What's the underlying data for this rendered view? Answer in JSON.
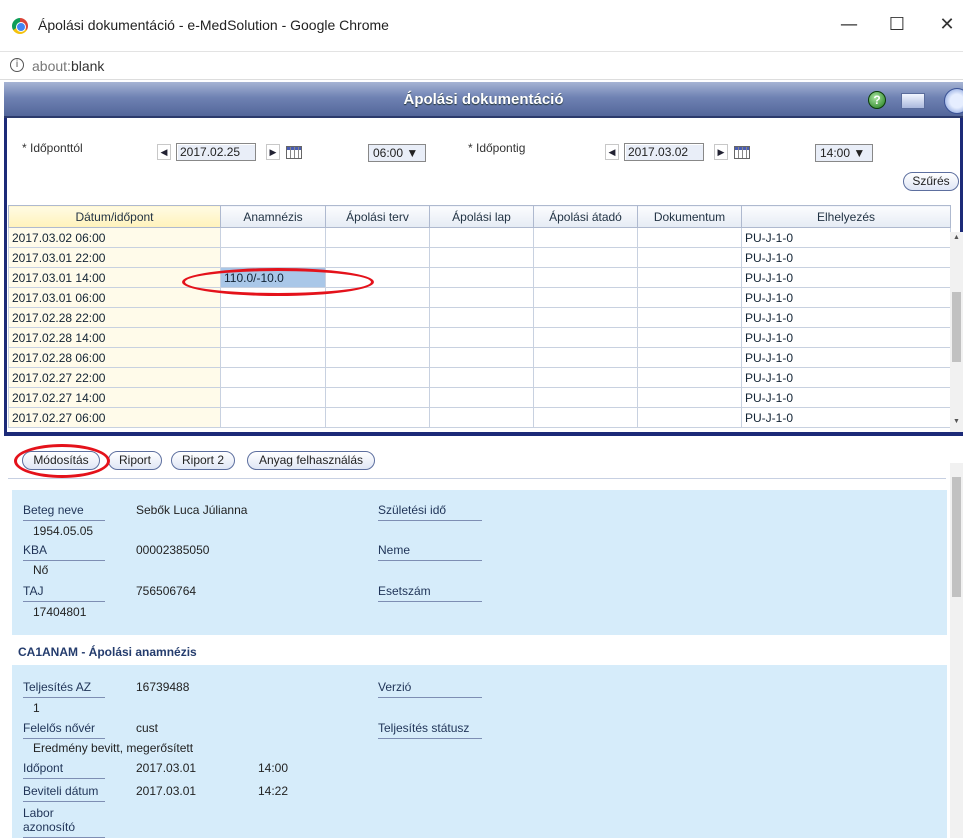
{
  "browser": {
    "window_title": "Ápolási dokumentáció - e-MedSolution - Google Chrome",
    "minimize": "—",
    "maximize": "☐",
    "close": "✕",
    "info_icon": "i",
    "address_prefix": "about:",
    "address_path": "blank"
  },
  "app": {
    "title": "Ápolási dokumentáció",
    "help_icon": "?"
  },
  "filter": {
    "from_label": "* Időponttól",
    "from_date": "2017.02.25",
    "from_time": "06:00 ▼",
    "to_label": "* Időpontig",
    "to_date": "2017.03.02",
    "to_time": "14:00 ▼",
    "prev_arrow": "◀",
    "next_arrow": "▶",
    "filter_button": "Szűrés"
  },
  "grid": {
    "columns": [
      "Dátum/időpont",
      "Anamnézis",
      "Ápolási terv",
      "Ápolási lap",
      "Ápolási átadó",
      "Dokumentum",
      "Elhelyezés"
    ],
    "rows": [
      [
        "2017.03.02 06:00",
        "",
        "",
        "",
        "",
        "",
        "PU-J-1-0"
      ],
      [
        "2017.03.01 22:00",
        "",
        "",
        "",
        "",
        "",
        "PU-J-1-0"
      ],
      [
        "2017.03.01 14:00",
        "110.0/-10.0",
        "",
        "",
        "",
        "",
        "PU-J-1-0"
      ],
      [
        "2017.03.01 06:00",
        "",
        "",
        "",
        "",
        "",
        "PU-J-1-0"
      ],
      [
        "2017.02.28 22:00",
        "",
        "",
        "",
        "",
        "",
        "PU-J-1-0"
      ],
      [
        "2017.02.28 14:00",
        "",
        "",
        "",
        "",
        "",
        "PU-J-1-0"
      ],
      [
        "2017.02.28 06:00",
        "",
        "",
        "",
        "",
        "",
        "PU-J-1-0"
      ],
      [
        "2017.02.27 22:00",
        "",
        "",
        "",
        "",
        "",
        "PU-J-1-0"
      ],
      [
        "2017.02.27 14:00",
        "",
        "",
        "",
        "",
        "",
        "PU-J-1-0"
      ],
      [
        "2017.02.27 06:00",
        "",
        "",
        "",
        "",
        "",
        "PU-J-1-0"
      ]
    ],
    "scroll_up": "▲",
    "scroll_down": "▼"
  },
  "actions": {
    "modify": "Módosítás",
    "report": "Riport",
    "report2": "Riport 2",
    "material": "Anyag felhasználás"
  },
  "patient": {
    "name_label": "Beteg neve",
    "name": "Sebők Luca Júlianna",
    "birth_label": "Születési idő",
    "birth": "1954.05.05",
    "kba_label": "KBA",
    "kba": "00002385050",
    "sex_label": "Neme",
    "sex": "Nő",
    "taj_label": "TAJ",
    "taj": "756506764",
    "case_label": "Esetszám",
    "case": "17404801"
  },
  "section": {
    "title": "CA1ANAM - Ápolási anamnézis",
    "fulfil_label": "Teljesítés AZ",
    "fulfil": "16739488",
    "version_label": "Verzió",
    "version": "1",
    "nurse_label": "Felelős nővér",
    "nurse": "cust",
    "status_label": "Teljesítés státusz",
    "status": "Eredmény bevitt, megerősített",
    "time_label": "Időpont",
    "time_date": "2017.03.01",
    "time_hour": "14:00",
    "entry_label": "Beviteli dátum",
    "entry_date": "2017.03.01",
    "entry_hour": "14:22",
    "lab_label": "Labor azonosító"
  },
  "annotations": {
    "ring_color": "#e4121b"
  }
}
